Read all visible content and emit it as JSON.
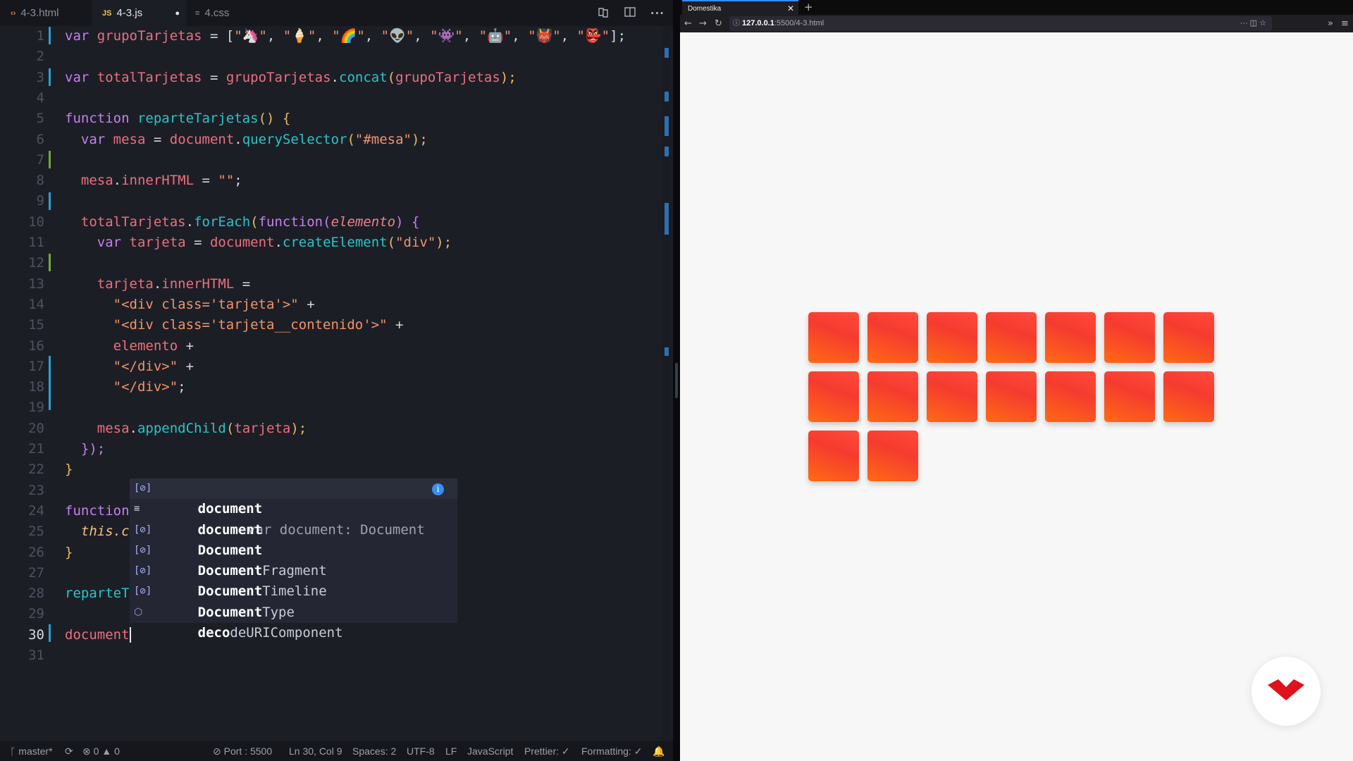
{
  "editor": {
    "tabs": [
      {
        "label": "4-3.html",
        "icon": "‹›"
      },
      {
        "label": "4-3.js",
        "icon": "JS",
        "modified": true
      },
      {
        "label": "4.css",
        "icon": "≡"
      }
    ],
    "modified_dot": "●",
    "code": [
      {
        "n": "1"
      },
      {
        "n": "2"
      },
      {
        "n": "3"
      },
      {
        "n": "4"
      },
      {
        "n": "5"
      },
      {
        "n": "6"
      },
      {
        "n": "7"
      },
      {
        "n": "8"
      },
      {
        "n": "9"
      },
      {
        "n": "10"
      },
      {
        "n": "11"
      },
      {
        "n": "12"
      },
      {
        "n": "13"
      },
      {
        "n": "14"
      },
      {
        "n": "15"
      },
      {
        "n": "16"
      },
      {
        "n": "17"
      },
      {
        "n": "18"
      },
      {
        "n": "19"
      },
      {
        "n": "20"
      },
      {
        "n": "21"
      },
      {
        "n": "22"
      },
      {
        "n": "23"
      },
      {
        "n": "24"
      },
      {
        "n": "25"
      },
      {
        "n": "26"
      },
      {
        "n": "27"
      },
      {
        "n": "28"
      },
      {
        "n": "29"
      },
      {
        "n": "30"
      },
      {
        "n": "31"
      }
    ],
    "emojis": [
      "🦄",
      "🍦",
      "🌈",
      "👽",
      "👾",
      "🤖",
      "👹",
      "👺"
    ],
    "lines": {
      "l1_a": "var",
      "l1_b": "grupoTarjetas",
      "l1_c": " = [",
      "l3_a": "var",
      "l3_b": "totalTarjetas",
      "l3_c": " = ",
      "l3_d": "grupoTarjetas",
      "l3_e": ".",
      "l3_f": "concat",
      "l3_g": "(",
      "l3_h": "grupoTarjetas",
      "l3_i": ");",
      "l5_a": "function",
      "l5_b": "reparteTarjetas",
      "l5_c": "() {",
      "l6_a": "var",
      "l6_b": "mesa",
      "l6_c": " = ",
      "l6_d": "document",
      "l6_e": ".",
      "l6_f": "querySelector",
      "l6_g": "(",
      "l6_h": "\"#mesa\"",
      "l6_i": ");",
      "l8_a": "mesa",
      "l8_b": ".",
      "l8_c": "innerHTML",
      "l8_d": " = ",
      "l8_e": "\"\"",
      "l8_f": ";",
      "l10_a": "totalTarjetas",
      "l10_b": ".",
      "l10_c": "forEach",
      "l10_d": "(",
      "l10_e": "function",
      "l10_f": "(",
      "l10_g": "elemento",
      "l10_h": ") {",
      "l11_a": "var",
      "l11_b": "tarjeta",
      "l11_c": " = ",
      "l11_d": "document",
      "l11_e": ".",
      "l11_f": "createElement",
      "l11_g": "(",
      "l11_h": "\"div\"",
      "l11_i": ");",
      "l13_a": "tarjeta",
      "l13_b": ".",
      "l13_c": "innerHTML",
      "l13_d": " =",
      "l14_a": "\"<div class='tarjeta'>\"",
      "l14_b": " +",
      "l15_a": "\"<div class='tarjeta__contenido'>\"",
      "l15_b": " +",
      "l16_a": "elemento",
      "l16_b": " +",
      "l17_a": "\"</div>\"",
      "l17_b": " +",
      "l18_a": "\"</div>\"",
      "l18_b": ";",
      "l20_a": "mesa",
      "l20_b": ".",
      "l20_c": "appendChild",
      "l20_d": "(",
      "l20_e": "tarjeta",
      "l20_f": ");",
      "l21_a": "});",
      "l22_a": "}",
      "l24_a": "function",
      "l25_a": "this.c",
      "l26_a": "}",
      "l28_a": "reparteT",
      "l30_a": "document"
    },
    "suggestions": [
      {
        "bold": "document",
        "rest": "",
        "detail": "var document: Document",
        "icon": "[⊘]"
      },
      {
        "bold": "document",
        "rest": "",
        "icon": "≡"
      },
      {
        "bold": "Document",
        "rest": "",
        "icon": "[⊘]"
      },
      {
        "bold": "Document",
        "rest": "Fragment",
        "icon": "[⊘]"
      },
      {
        "bold": "Document",
        "rest": "Timeline",
        "icon": "[⊘]"
      },
      {
        "bold": "Document",
        "rest": "Type",
        "icon": "[⊘]"
      },
      {
        "pre": "",
        "bold": "deco",
        "rest": "deURIComponent",
        "icon": "⬡"
      }
    ],
    "suggest_info": "i",
    "status": {
      "branch": "master*",
      "errors": "0",
      "warnings": "0",
      "port": "Port : 5500",
      "position": "Ln 30, Col 9",
      "spaces": "Spaces: 2",
      "encoding": "UTF-8",
      "eol": "LF",
      "language": "JavaScript",
      "prettier": "Prettier: ✓",
      "formatting": "Formatting: ✓"
    }
  },
  "browser": {
    "tab_title": "Domestika",
    "url_host": "127.0.0.1",
    "url_rest": ":5500/4-3.html",
    "cards_count": 16,
    "cards_per_row": 7,
    "card_color_start": "#ff4a3a",
    "card_color_end": "#ff6a14",
    "logo_color": "#e0121b"
  }
}
